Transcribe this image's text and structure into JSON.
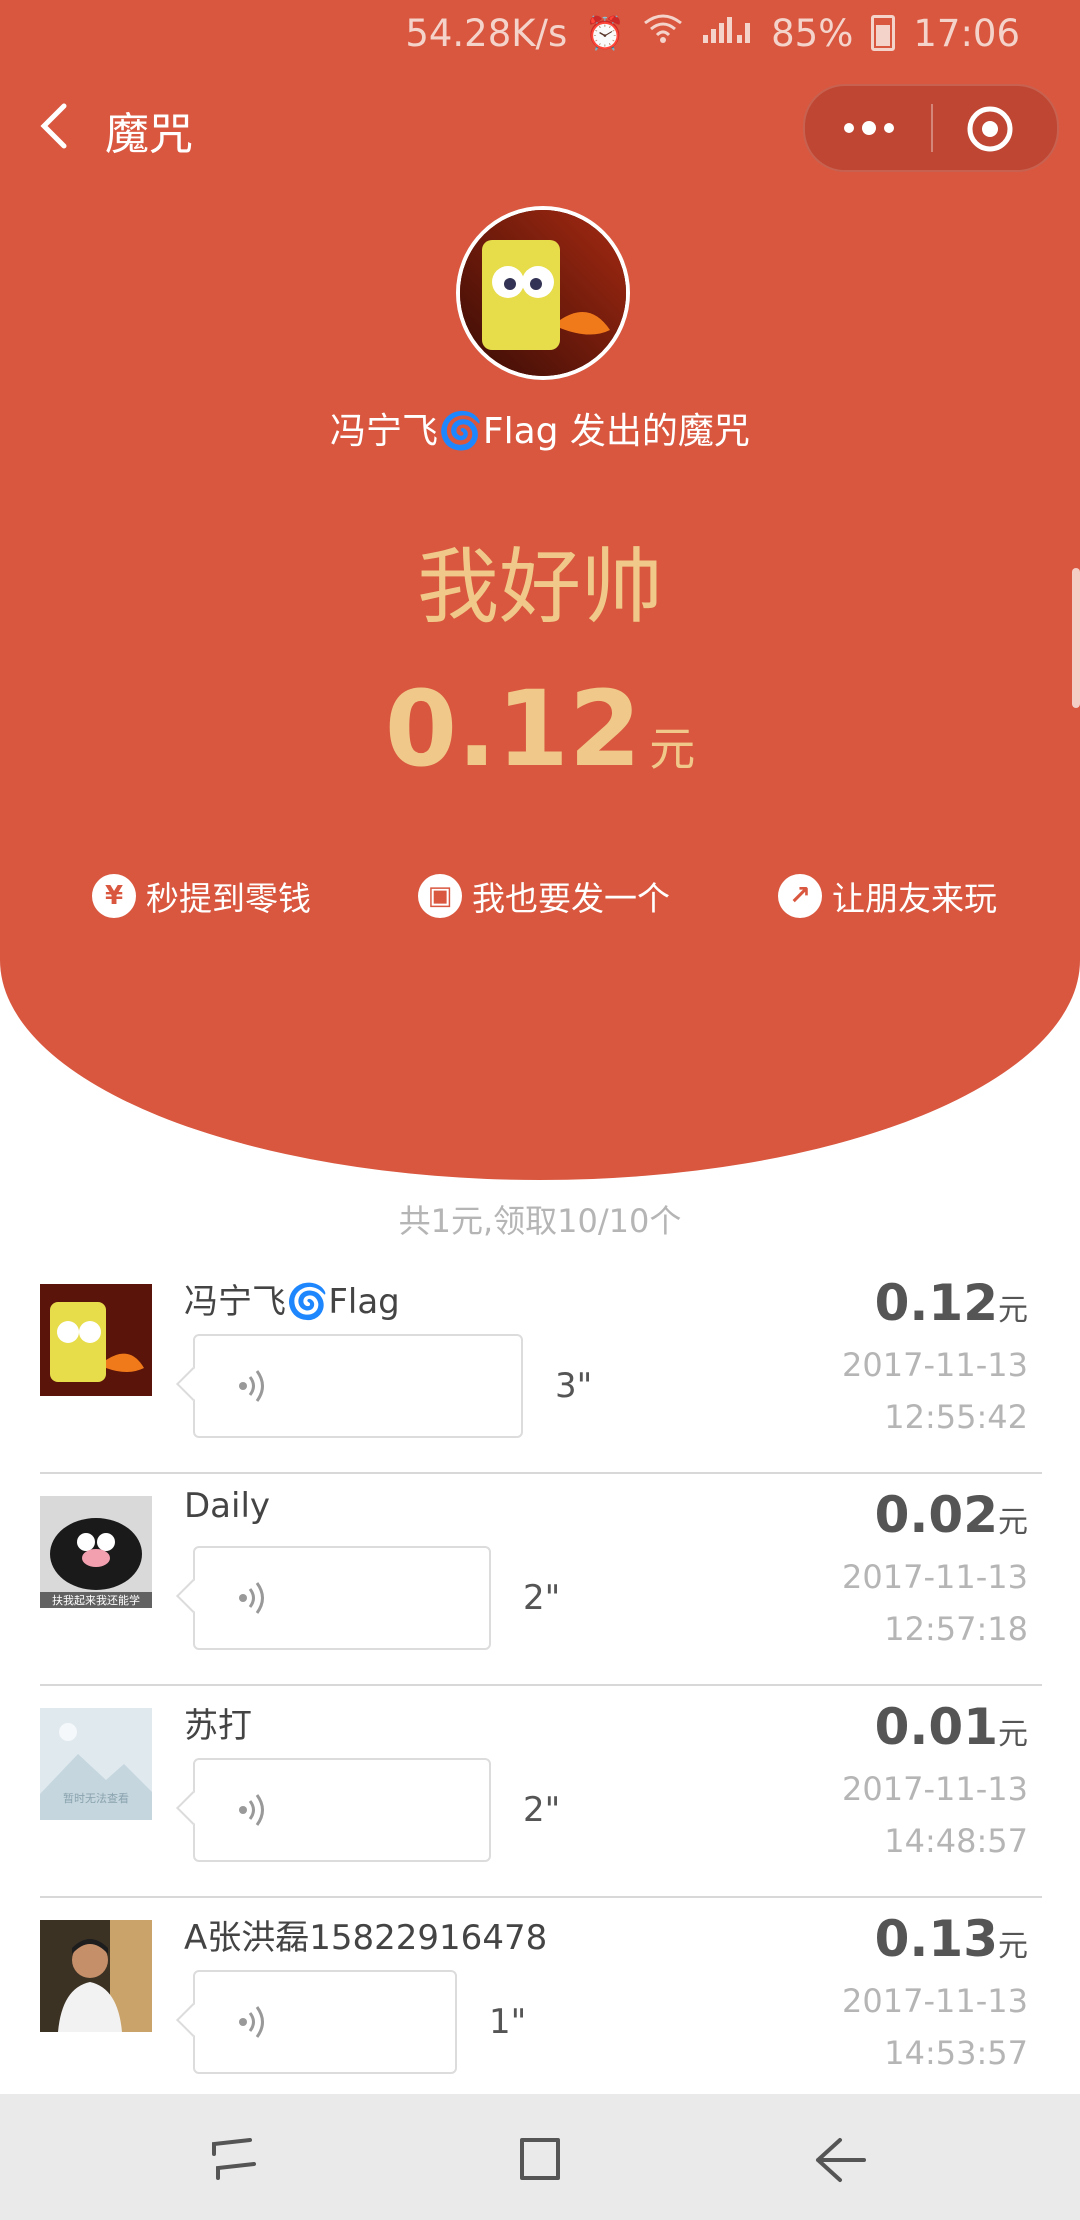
{
  "status_bar": {
    "speed": "54.28K/s",
    "battery": "85%",
    "time": "17:06",
    "icons": [
      "alarm-icon",
      "wifi-icon",
      "signal-icon",
      "battery-icon"
    ]
  },
  "header": {
    "title": "魔咒",
    "back_icon": "chevron-left-icon",
    "capsule_icons": [
      "more-icon",
      "close-icon"
    ]
  },
  "hero": {
    "sender_text": "冯宁飞🌀Flag 发出的魔咒",
    "spell": "我好帅",
    "amount": "0.12",
    "amount_unit": "元",
    "actions": [
      {
        "label": "秒提到零钱",
        "icon": "yuan-icon",
        "glyph": "¥"
      },
      {
        "label": "我也要发一个",
        "icon": "red-packet-icon",
        "glyph": "▣"
      },
      {
        "label": "让朋友来玩",
        "icon": "share-icon",
        "glyph": "↗"
      }
    ]
  },
  "summary": "共1元,领取10/10个",
  "records": [
    {
      "name": "冯宁飞🌀Flag",
      "duration": "3\"",
      "amount": "0.12",
      "unit": "元",
      "date": "2017-11-13",
      "time": "12:55:42"
    },
    {
      "name": "Daily",
      "duration": "2\"",
      "amount": "0.02",
      "unit": "元",
      "date": "2017-11-13",
      "time": "12:57:18"
    },
    {
      "name": "苏打",
      "duration": "2\"",
      "amount": "0.01",
      "unit": "元",
      "date": "2017-11-13",
      "time": "14:48:57"
    },
    {
      "name": "A张洪磊15822916478",
      "duration": "1\"",
      "amount": "0.13",
      "unit": "元",
      "date": "2017-11-13",
      "time": "14:53:57"
    }
  ],
  "avatar_captions": {
    "daily": "扶我起来我还能学",
    "placeholder": "暂时无法查看"
  },
  "colors": {
    "hero_bg": "#d9573f",
    "gold": "#f0c98a",
    "list_text": "#444444",
    "muted": "#b5b5b5"
  },
  "nav": [
    "recent-apps-icon",
    "home-icon",
    "back-arrow-icon"
  ]
}
